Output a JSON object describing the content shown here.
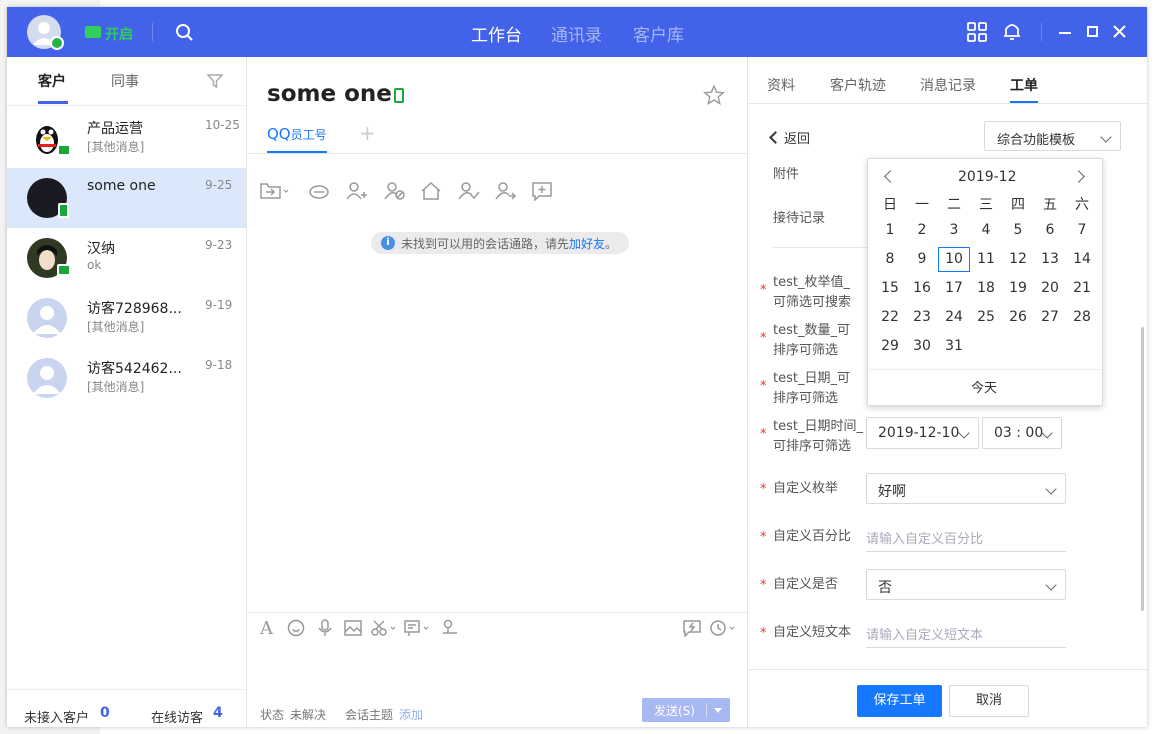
{
  "topbar": {
    "status_label": "开启",
    "nav": [
      "工作台",
      "通讯录",
      "客户库"
    ]
  },
  "sidebar": {
    "tabs": [
      "客户",
      "同事"
    ],
    "conversations": [
      {
        "name": "产品运营",
        "preview": "[其他消息]",
        "date": "10-25"
      },
      {
        "name": "some one",
        "preview": "",
        "date": "9-25"
      },
      {
        "name": "汉纳",
        "preview": "ok",
        "date": "9-23"
      },
      {
        "name": "访客728968...",
        "preview": "[其他消息]",
        "date": "9-19"
      },
      {
        "name": "访客542462...",
        "preview": "[其他消息]",
        "date": "9-18"
      }
    ],
    "footer": {
      "unaccepted_label": "未接入客户",
      "unaccepted_count": "0",
      "online_label": "在线访客",
      "online_count": "4"
    }
  },
  "chat": {
    "title": "some one",
    "channel_tab": "QQ",
    "channel_sub": "员工号",
    "plus": "+",
    "notice_text": "未找到可以用的会话通路，请先",
    "notice_link": "加好友",
    "notice_end": "。",
    "status_label": "状态",
    "status_value": "未解决",
    "topic_label": "会话主题",
    "topic_add": "添加",
    "send_label": "发送(S)"
  },
  "panel": {
    "tabs": [
      "资料",
      "客户轨迹",
      "消息记录",
      "工单"
    ],
    "back": "返回",
    "template": "综合功能模板",
    "attachment": "附件",
    "reception": "接待记录",
    "fields": {
      "enum": "test_枚举值_可筛选可搜索",
      "number": "test_数量_可排序可筛选",
      "date": "test_日期_可排序可筛选",
      "datetime": "test_日期时间_可排序可筛选",
      "custom_enum": "自定义枚举",
      "custom_percent": "自定义百分比",
      "custom_bool": "自定义是否",
      "custom_text": "自定义短文本"
    },
    "values": {
      "datetime_date": "2019-12-10",
      "datetime_time": "03 : 00",
      "custom_enum": "好啊",
      "custom_bool": "否"
    },
    "placeholders": {
      "custom_percent": "请输入自定义百分比",
      "custom_text": "请输入自定义短文本"
    },
    "save": "保存工单",
    "cancel": "取消"
  },
  "calendar": {
    "month": "2019-12",
    "weekdays": [
      "日",
      "一",
      "二",
      "三",
      "四",
      "五",
      "六"
    ],
    "days": [
      "1",
      "2",
      "3",
      "4",
      "5",
      "6",
      "7",
      "8",
      "9",
      "10",
      "11",
      "12",
      "13",
      "14",
      "15",
      "16",
      "17",
      "18",
      "19",
      "20",
      "21",
      "22",
      "23",
      "24",
      "25",
      "26",
      "27",
      "28",
      "29",
      "30",
      "31"
    ],
    "selected": "10",
    "today": "今天"
  },
  "colors": {
    "brand": "#4262e9",
    "accent": "#1677ff",
    "green": "#1ba83a",
    "required": "#e53935"
  }
}
